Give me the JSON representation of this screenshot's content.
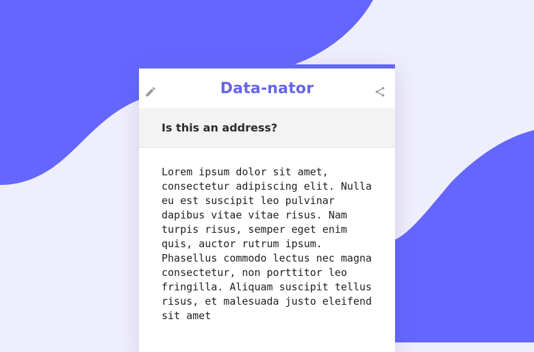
{
  "app": {
    "title": "Data-nator"
  },
  "question": {
    "label": "Is this an address?"
  },
  "content": {
    "text": "Lorem ipsum dolor sit amet, consectetur adipiscing elit. Nulla eu est suscipit leo pulvinar dapibus vitae vitae risus. Nam turpis risus, semper eget enim quis, auctor rutrum ipsum. Phasellus commodo lectus nec magna consectetur, non porttitor leo fringilla. Aliquam suscipit tellus risus, et malesuada justo eleifend sit amet"
  },
  "icons": {
    "left": "pencil-icon",
    "right": "share-icon"
  },
  "colors": {
    "accent": "#6466ff",
    "title": "#6566e6",
    "background_light": "#efeefc",
    "question_bar": "#f3f3f3"
  }
}
